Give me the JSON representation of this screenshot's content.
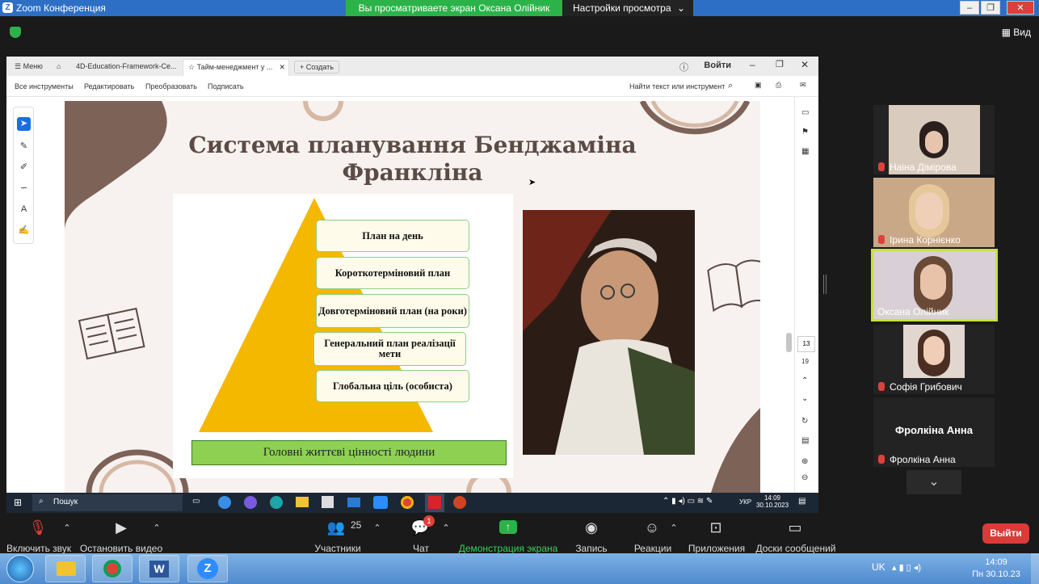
{
  "zoom": {
    "window_title": "Zoom Конференция",
    "share_banner": "Вы просматриваете экран Оксана Олійник",
    "view_settings": "Настройки просмотра",
    "view_button": "Вид",
    "leave_label": "Выйти"
  },
  "app": {
    "menu_label": "Меню",
    "tabs": [
      "4D-Education-Framework-Ce...",
      "Тайм-менеджмент у ..."
    ],
    "new_tab": "Создать",
    "sign_in": "Войти",
    "toolbar": {
      "all_tools": "Все инструменты",
      "edit": "Редактировать",
      "convert": "Преобразовать",
      "sign": "Подписать",
      "search": "Найти текст или инструмент"
    },
    "page_current": "13",
    "page_total": "19"
  },
  "slide": {
    "title_line1": "Система планування Бенджаміна",
    "title_line2": "Франкліна",
    "pyramid_items": [
      "План на день",
      "Короткотерміновий план",
      "Довготерміновий план (на роки)",
      "Генеральний план реалізації мети",
      "Глобальна ціль (особиста)"
    ],
    "values_bar": "Головні життєві цінності людини"
  },
  "participants": [
    "Наіна Дімірова",
    "Ірина Корнієнко",
    "Оксана Олійник",
    "Софія Грибович",
    "Фролкіна Анна"
  ],
  "participant_big_name": "Фролкіна Анна",
  "inner_taskbar": {
    "search": "Пошук",
    "lang": "УКР",
    "time": "14:09",
    "date": "30.10.2023"
  },
  "controls": {
    "unmute": "Включить звук",
    "stop_video": "Остановить видео",
    "participants": "Участники",
    "participants_count": "25",
    "chat": "Чат",
    "chat_badge": "1",
    "share": "Демонстрация экрана",
    "record": "Запись",
    "reactions": "Реакции",
    "apps": "Приложения",
    "whiteboards": "Доски сообщений"
  },
  "outer_taskbar": {
    "lang": "UK",
    "time": "14:09",
    "date": "Пн 30.10.23"
  },
  "colors": {
    "share_banner": "#2bb34a",
    "pyramid": "#f5b800",
    "leave": "#d83b38"
  }
}
